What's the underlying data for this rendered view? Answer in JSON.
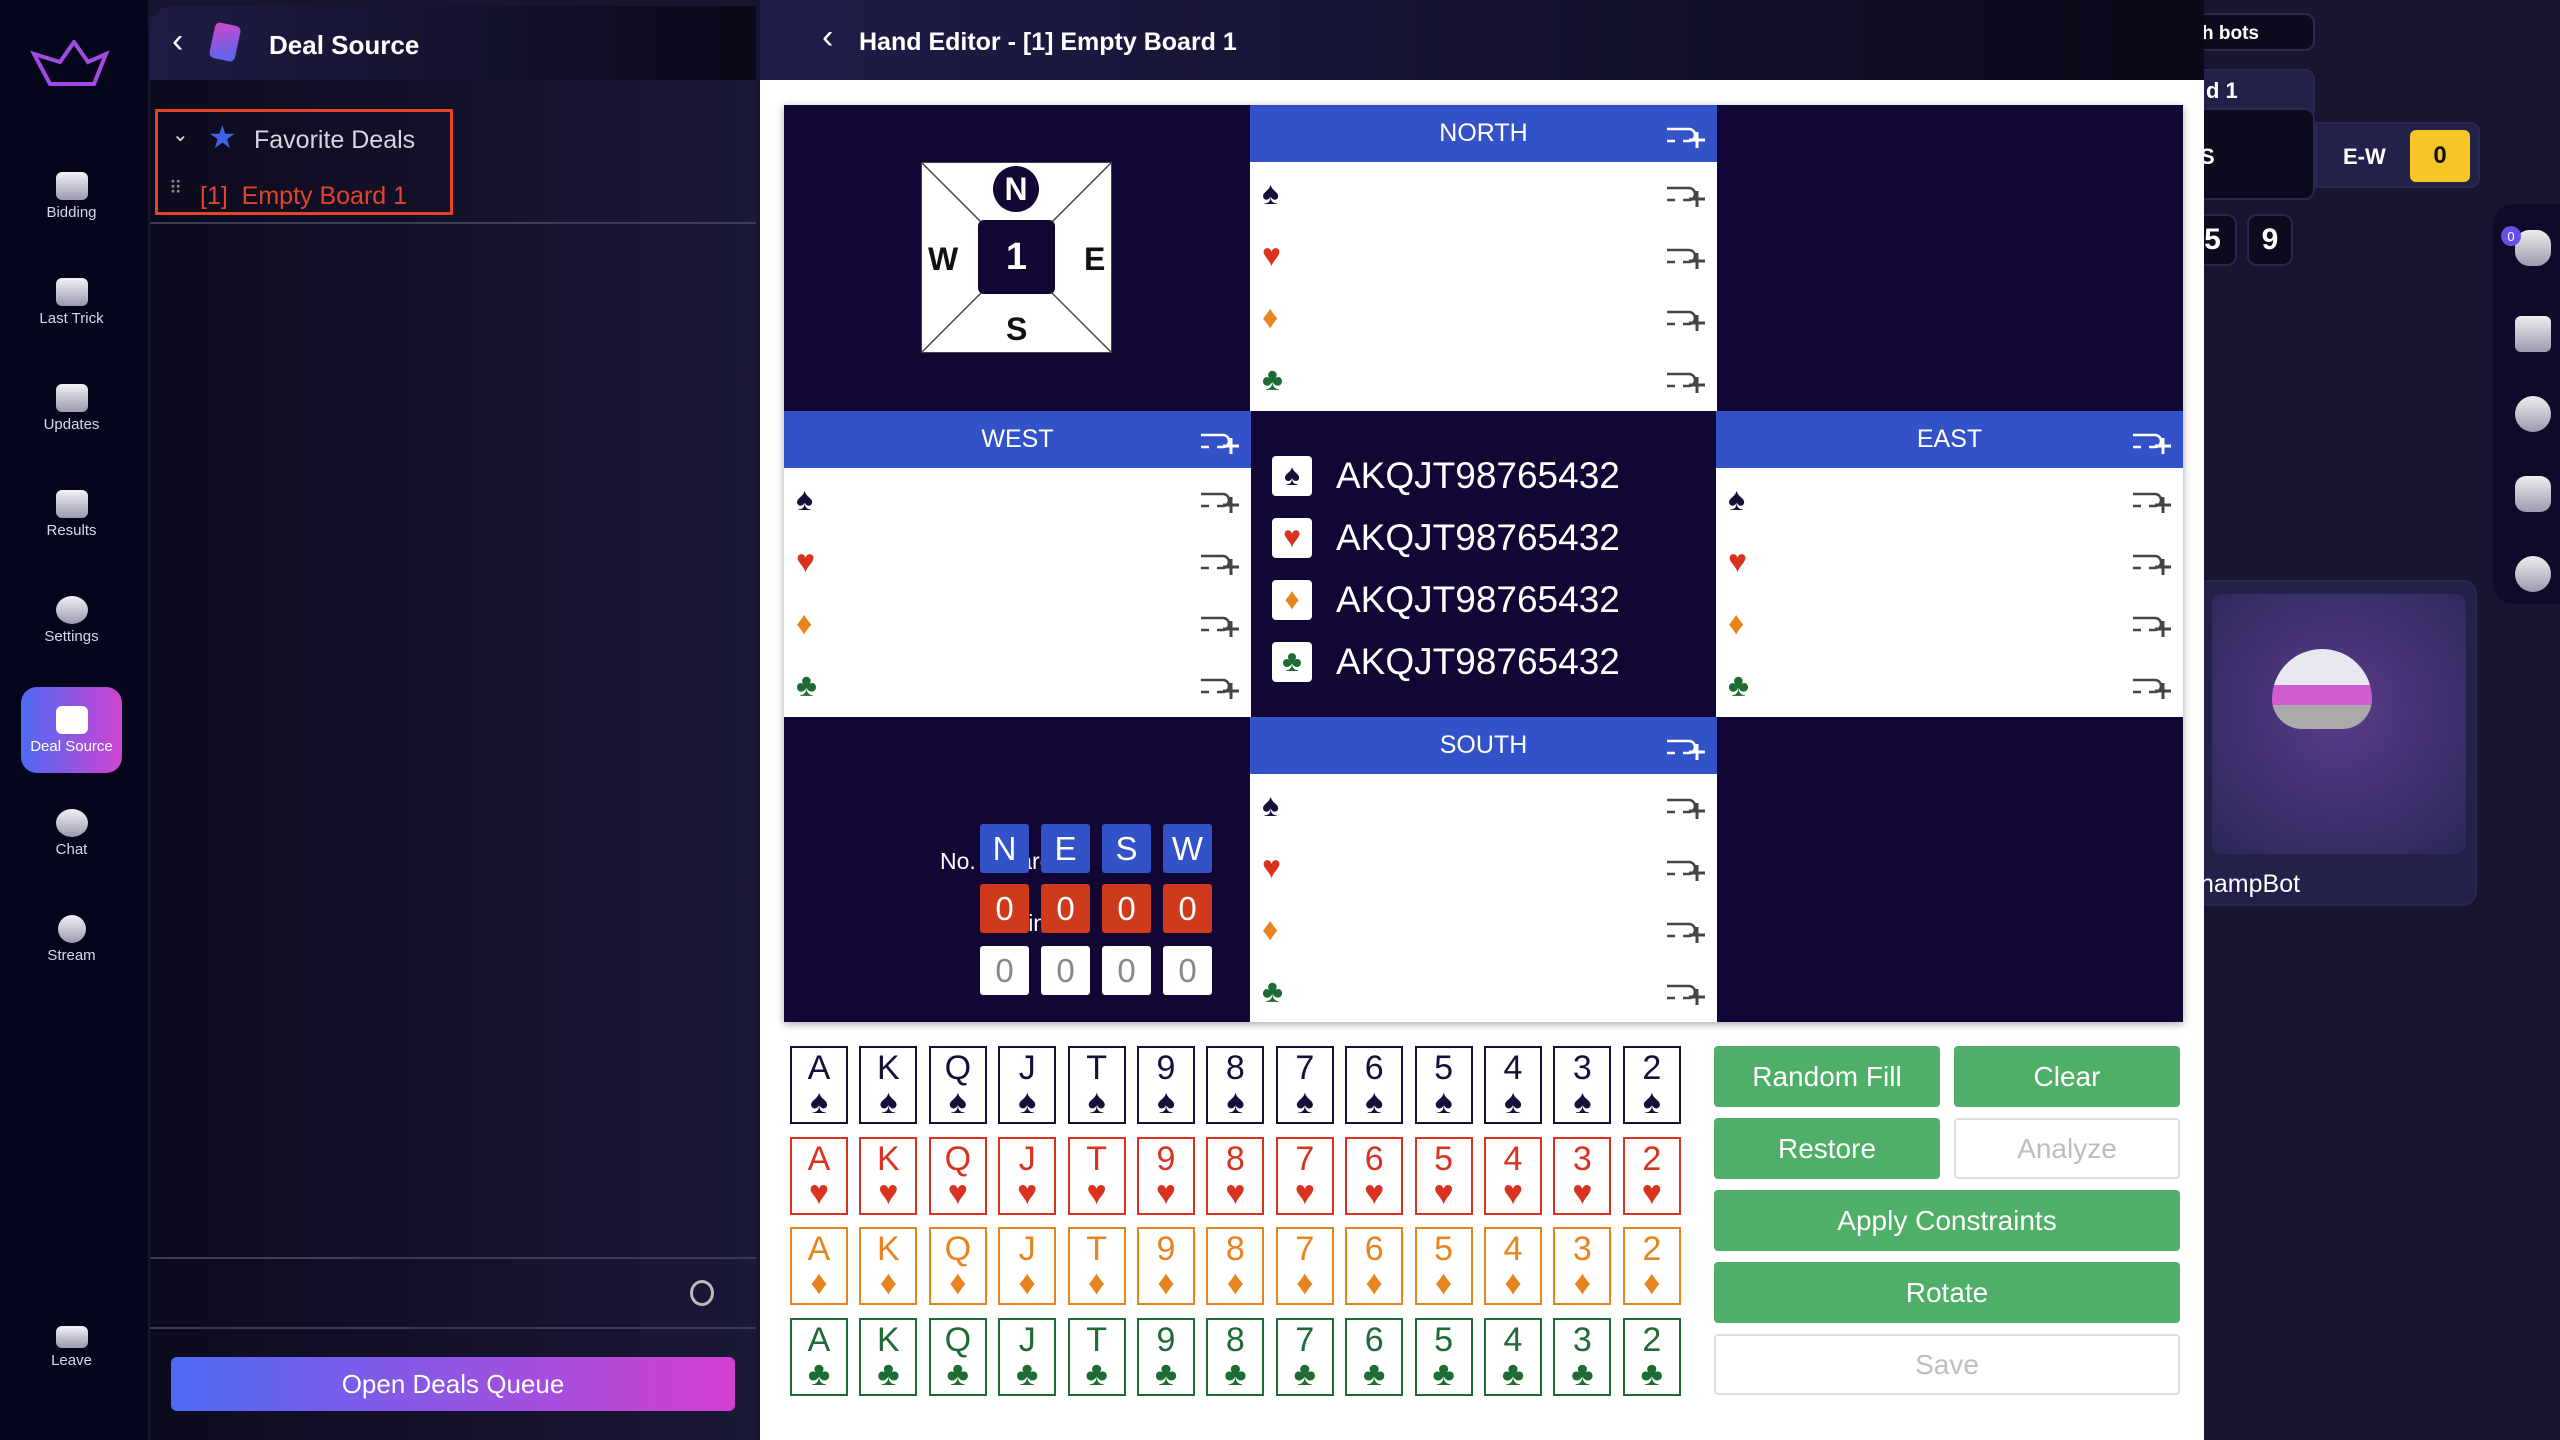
{
  "nav": {
    "items": [
      {
        "label": "Bidding",
        "icon": "gavel-icon"
      },
      {
        "label": "Last Trick",
        "icon": "last-trick-icon"
      },
      {
        "label": "Updates",
        "icon": "updates-icon"
      },
      {
        "label": "Results",
        "icon": "results-icon"
      },
      {
        "label": "Settings",
        "icon": "gear-icon"
      },
      {
        "label": "Deal Source",
        "icon": "cards-icon",
        "active": true
      },
      {
        "label": "Chat",
        "icon": "chat-icon"
      },
      {
        "label": "Stream",
        "icon": "stream-icon"
      }
    ],
    "leave": "Leave"
  },
  "deal_source": {
    "title": "Deal Source",
    "group": "Favorite Deals",
    "item": "[1]  Empty Board 1",
    "open_queue": "Open Deals Queue"
  },
  "hand_editor": {
    "title": "Hand Editor - [1] Empty Board 1",
    "board_number": "1",
    "compass": {
      "n": "N",
      "e": "E",
      "s": "S",
      "w": "W"
    },
    "hands": {
      "north": "NORTH",
      "west": "WEST",
      "east": "EAST",
      "south": "SOUTH"
    },
    "remaining": [
      "AKQJT98765432",
      "AKQJT98765432",
      "AKQJT98765432",
      "AKQJT98765432"
    ],
    "summary": {
      "seats": [
        "N",
        "E",
        "S",
        "W"
      ],
      "cards_label": "No. of cards",
      "cards": [
        "0",
        "0",
        "0",
        "0"
      ],
      "points_label": "Points",
      "points": [
        "0",
        "0",
        "0",
        "0"
      ]
    },
    "ranks": [
      "A",
      "K",
      "Q",
      "J",
      "T",
      "9",
      "8",
      "7",
      "6",
      "5",
      "4",
      "3",
      "2"
    ],
    "suits": [
      {
        "name": "spades",
        "symbol": "♠",
        "color": "#14103a"
      },
      {
        "name": "hearts",
        "symbol": "♥",
        "color": "#d9331f"
      },
      {
        "name": "diamonds",
        "symbol": "♦",
        "color": "#e8841f"
      },
      {
        "name": "clubs",
        "symbol": "♣",
        "color": "#1e6b33"
      }
    ],
    "buttons": {
      "random_fill": "Random Fill",
      "clear": "Clear",
      "restore": "Restore",
      "analyze": "Analyze",
      "apply": "Apply Constraints",
      "rotate": "Rotate",
      "save": "Save"
    }
  },
  "right": {
    "bots_tab": "h bots",
    "board_tab": "d 1",
    "ns_label": "S",
    "ew_label": "E-W",
    "ew_score": "0",
    "tiles": [
      "5",
      "9"
    ],
    "bot_name": "hampBot",
    "viewer_count": "0"
  },
  "colors": {
    "accent_blue": "#3352c8",
    "cards_red": "#cf3a1c",
    "green": "#4fae68",
    "yellow": "#f5c526"
  }
}
